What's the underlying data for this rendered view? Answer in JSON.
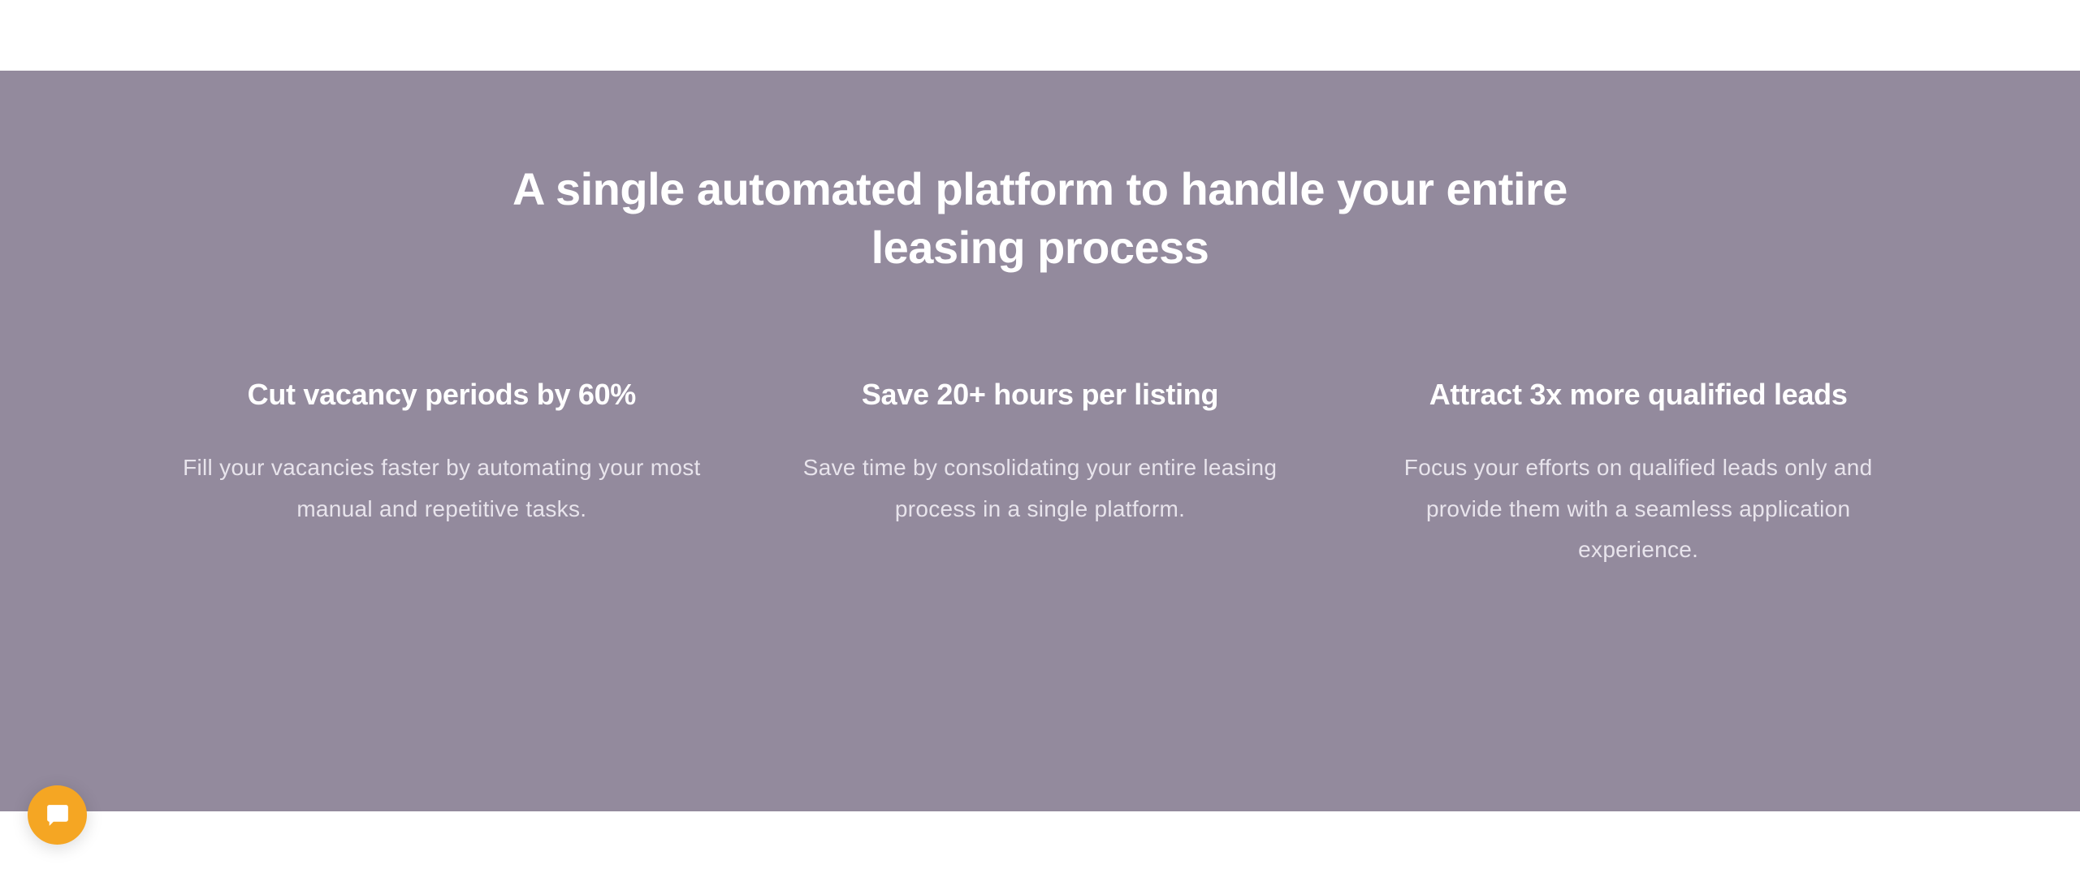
{
  "heading": "A single automated platform to handle your entire leasing process",
  "features": [
    {
      "title": "Cut vacancy periods by 60%",
      "description": "Fill your vacancies faster by automating your most manual and repetitive tasks."
    },
    {
      "title": "Save 20+ hours per listing",
      "description": "Save time by consolidating your entire leasing process in a single platform."
    },
    {
      "title": "Attract 3x more qualified leads",
      "description": "Focus your efforts on qualified leads only and provide them with a seamless application experience."
    }
  ]
}
